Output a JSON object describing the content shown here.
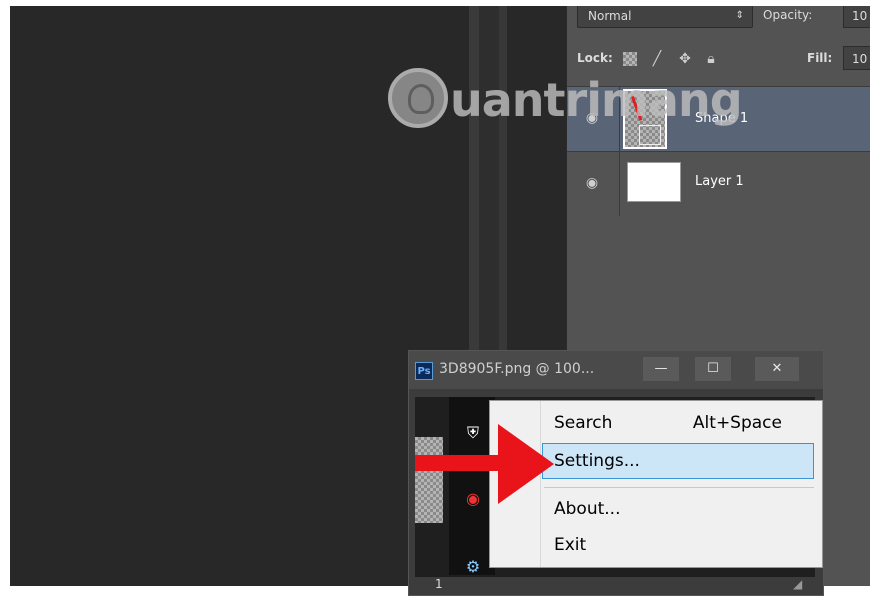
{
  "layers_panel": {
    "blend_mode": "Normal",
    "opacity_label": "Opacity:",
    "opacity_value": "10",
    "lock_label": "Lock:",
    "fill_label": "Fill:",
    "fill_value": "10",
    "layers": [
      {
        "name": "Shape 1",
        "selected": true
      },
      {
        "name": "Layer 1",
        "selected": false
      }
    ]
  },
  "watermark": {
    "text": "uantrimang"
  },
  "ps_window": {
    "app_badge": "Ps",
    "title": "3D8905F.png @ 100...",
    "minimize": "—",
    "maximize": "☐",
    "close": "✕",
    "status_zoom": "1"
  },
  "context_menu": {
    "items": [
      {
        "label": "Search",
        "shortcut": "Alt+Space",
        "highlighted": false
      },
      {
        "label": "Settings...",
        "shortcut": "",
        "highlighted": true
      },
      {
        "label": "About...",
        "shortcut": "",
        "highlighted": false
      },
      {
        "label": "Exit",
        "shortcut": "",
        "highlighted": false
      }
    ]
  },
  "colors": {
    "highlight_bg": "#cde6f7",
    "highlight_border": "#3c94d6",
    "arrow": "#e8141a",
    "selected_layer": "#596577"
  }
}
